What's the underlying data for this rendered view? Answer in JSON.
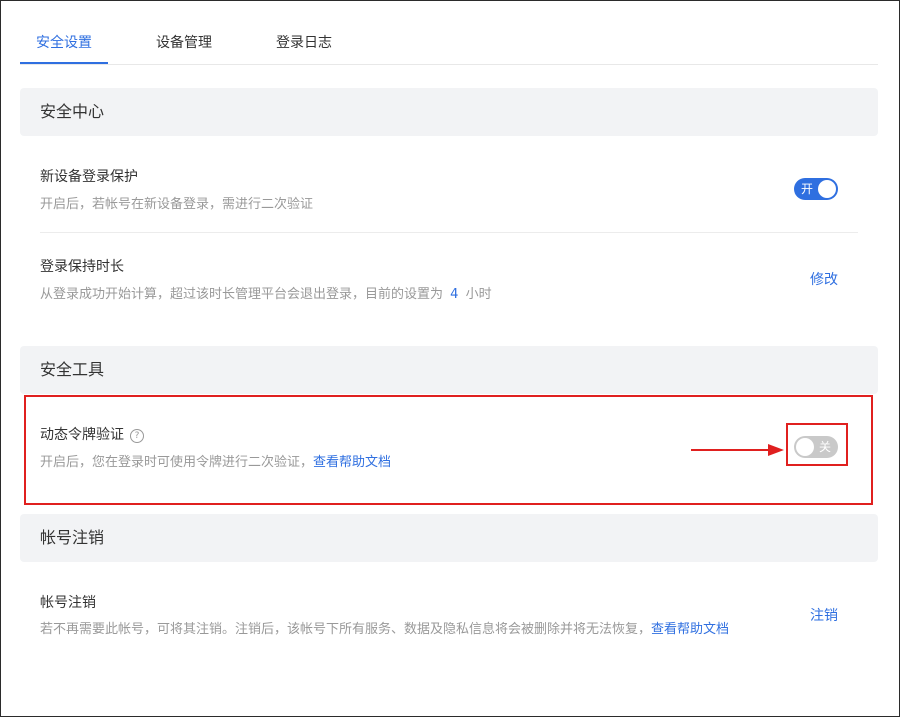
{
  "tabs": [
    {
      "label": "安全设置",
      "active": true
    },
    {
      "label": "设备管理",
      "active": false
    },
    {
      "label": "登录日志",
      "active": false
    }
  ],
  "security_center": {
    "title": "安全中心",
    "new_device": {
      "title": "新设备登录保护",
      "desc": "开启后，若帐号在新设备登录，需进行二次验证",
      "switch_text": "开",
      "enabled": true
    },
    "session": {
      "title": "登录保持时长",
      "desc_prefix": "从登录成功开始计算，超过该时长管理平台会退出登录，目前的设置为",
      "value": "4",
      "unit": "小时",
      "action": "修改"
    }
  },
  "security_tools": {
    "title": "安全工具",
    "token": {
      "title": "动态令牌验证",
      "help_glyph": "?",
      "desc": "开启后，您在登录时可使用令牌进行二次验证，",
      "help_link": "查看帮助文档",
      "switch_text": "关",
      "enabled": false
    }
  },
  "account_cancel": {
    "title": "帐号注销",
    "row": {
      "title": "帐号注销",
      "desc": "若不再需要此帐号，可将其注销。注销后，该帐号下所有服务、数据及隐私信息将会被删除并将无法恢复，",
      "help_link": "查看帮助文档",
      "action": "注销"
    }
  },
  "colors": {
    "accent": "#2f6fe0",
    "highlight": "#e0201f"
  }
}
